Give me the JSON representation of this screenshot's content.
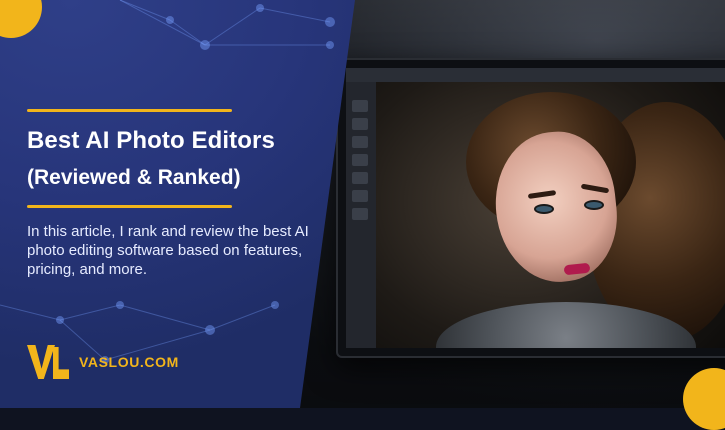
{
  "hero": {
    "title": "Best AI Photo Editors",
    "subtitle": "(Reviewed & Ranked)",
    "description": "In this article, I rank and review the best AI photo editing software based on features, pricing, and more."
  },
  "brand": {
    "name": "VASLOU.COM"
  },
  "colors": {
    "panel_blue": "#27357a",
    "accent_gold": "#f2b51b",
    "text_white": "#ffffff"
  },
  "imagery": {
    "right_image": "laptop-photo-editor-portrait"
  }
}
